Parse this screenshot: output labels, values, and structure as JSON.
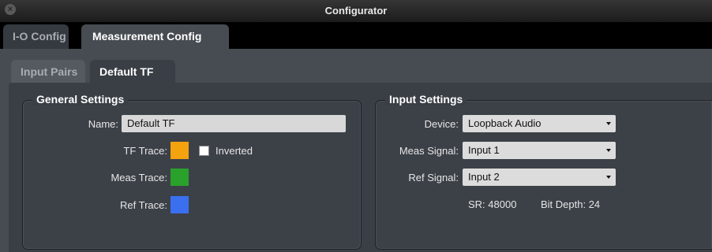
{
  "window": {
    "title": "Configurator"
  },
  "main_tabs": [
    {
      "label": "I-O Config",
      "active": false
    },
    {
      "label": "Measurement Config",
      "active": true
    }
  ],
  "sub_tabs": [
    {
      "label": "Input Pairs",
      "active": false
    },
    {
      "label": "Default TF",
      "active": true
    }
  ],
  "general": {
    "title": "General Settings",
    "name_label": "Name:",
    "name_value": "Default TF",
    "tf_trace_label": "TF Trace:",
    "tf_trace_color": "#f5a20f",
    "inverted_label": "Inverted",
    "inverted_checked": false,
    "meas_trace_label": "Meas Trace:",
    "meas_trace_color": "#2aa12a",
    "ref_trace_label": "Ref Trace:",
    "ref_trace_color": "#3a70ef"
  },
  "input": {
    "title": "Input Settings",
    "device_label": "Device:",
    "device_value": "Loopback Audio",
    "meas_signal_label": "Meas Signal:",
    "meas_signal_value": "Input 1",
    "ref_signal_label": "Ref Signal:",
    "ref_signal_value": "Input 2",
    "sr_text": "SR: 48000",
    "bit_depth_text": "Bit Depth: 24"
  },
  "icons": {
    "close": "close-icon"
  }
}
